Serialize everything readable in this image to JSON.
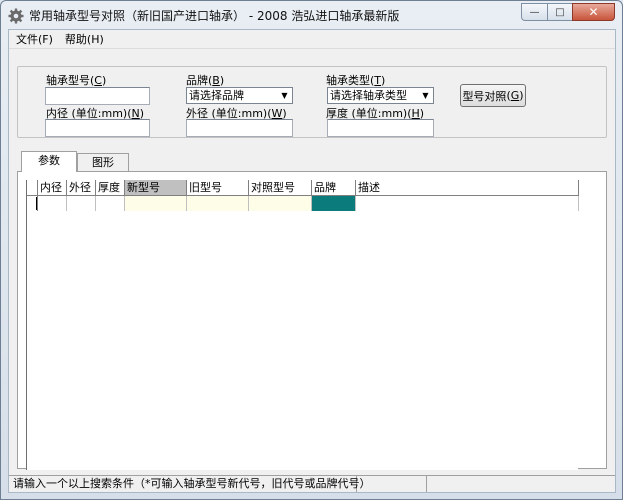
{
  "window": {
    "title": "常用轴承型号对照（新旧国产进口轴承） - 2008 浩弘进口轴承最新版",
    "min_glyph": "—",
    "max_glyph": "□",
    "close_glyph": "✕"
  },
  "menu": [
    {
      "label": "文件(F)"
    },
    {
      "label": "帮助(H)"
    }
  ],
  "form": {
    "bearing_no_label": "轴承型号",
    "bearing_no_key": "C",
    "bearing_no_value": "",
    "brand_label": "品牌",
    "brand_key": "B",
    "brand_selected": "请选择品牌",
    "type_label": "轴承类型",
    "type_key": "T",
    "type_selected": "请选择轴承类型",
    "inner_label": "内径 (单位:mm)",
    "inner_key": "N",
    "inner_value": "",
    "outer_label": "外径 (单位:mm)",
    "outer_key": "W",
    "outer_value": "",
    "thick_label": "厚度 (单位:mm)",
    "thick_key": "H",
    "thick_value": "",
    "compare_button": "型号对照",
    "compare_key": "G",
    "dropdown_glyph": "▼"
  },
  "tabs": [
    {
      "label": "参数",
      "active": true
    },
    {
      "label": "图形",
      "active": false
    }
  ],
  "grid": {
    "columns": [
      "内径",
      "外径",
      "厚度",
      "新型号",
      "旧型号",
      "对照型号",
      "品牌",
      "描述"
    ],
    "selected_column": "新型号",
    "rows": [
      [
        "",
        "",
        "",
        "",
        "",
        "",
        "",
        ""
      ]
    ]
  },
  "status": {
    "message": "请输入一个以上搜索条件（*可输入轴承型号新代号，旧代号或品牌代号）"
  },
  "colors": {
    "highlight_cell": "#0b7b7b",
    "editable_cell": "#fefde8"
  }
}
